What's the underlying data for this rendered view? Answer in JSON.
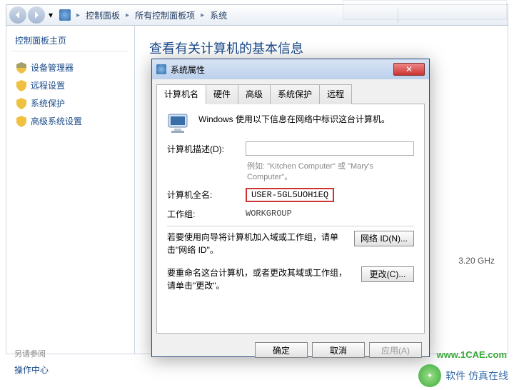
{
  "breadcrumb": {
    "seg1": "控制面板",
    "seg2": "所有控制面板项",
    "seg3": "系统",
    "sep": "▸"
  },
  "sidebar": {
    "title": "控制面板主页",
    "items": [
      {
        "label": "设备管理器"
      },
      {
        "label": "远程设置"
      },
      {
        "label": "系统保护"
      },
      {
        "label": "高级系统设置"
      }
    ],
    "see_also": "另请参阅",
    "action_center": "操作中心"
  },
  "page": {
    "title": "查看有关计算机的基本信息",
    "right_spec": "3.20 GHz",
    "right_unit": "z"
  },
  "dialog": {
    "title": "系统属性",
    "tabs": {
      "computer_name": "计算机名",
      "hardware": "硬件",
      "advanced": "高级",
      "protection": "系统保护",
      "remote": "远程"
    },
    "intro": "Windows 使用以下信息在网络中标识这台计算机。",
    "desc_label": "计算机描述(D):",
    "example": "例如: \"Kitchen Computer\" 或 \"Mary's Computer\"。",
    "fullname_label": "计算机全名:",
    "fullname_value": "USER-5GL5UOH1EQ",
    "workgroup_label": "工作组:",
    "workgroup_value": "WORKGROUP",
    "note1": "若要使用向导将计算机加入域或工作组，请单击\"网络 ID\"。",
    "btn_network_id": "网络 ID(N)...",
    "note2": "要重命名这台计算机，或者更改其域或工作组，请单击\"更改\"。",
    "btn_change": "更改(C)...",
    "btn_ok": "确定",
    "btn_cancel": "取消",
    "btn_apply": "应用(A)",
    "close_x": "✕"
  },
  "watermark": {
    "url": "www.1CAE.com",
    "brand": "软件 仿真在线"
  }
}
